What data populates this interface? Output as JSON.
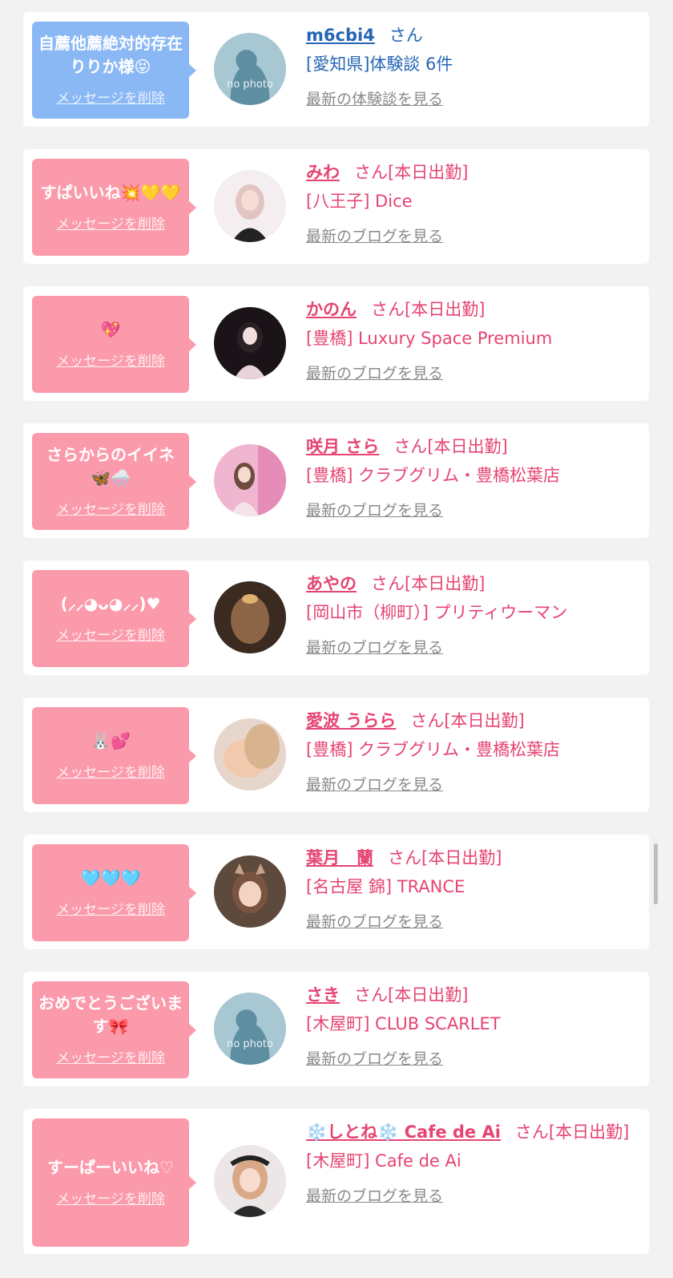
{
  "delete_label": "メッセージを削除",
  "san_label": "さん",
  "entries": [
    {
      "message": "自薦他薦絶対的存在りりか様😝",
      "name": "m6cbi4",
      "status": "",
      "shop": "[愛知県]体験談 6件",
      "link": "最新の体験談を見る",
      "avatar": "no photo",
      "color": "#2566b5"
    },
    {
      "message": "すぱいいね💥💛💛",
      "name": "みわ",
      "status": "[本日出勤]",
      "shop": "[八王子] Dice",
      "link": "最新のブログを見る",
      "avatar": "photo",
      "color": "#e64472"
    },
    {
      "message": "💖",
      "name": "かのん",
      "status": "[本日出勤]",
      "shop": "[豊橋] Luxury Space Premium",
      "link": "最新のブログを見る",
      "avatar": "photo",
      "color": "#e64472"
    },
    {
      "message": "さらからのイイネ🦋🌨️",
      "name": "咲月 さら",
      "status": "[本日出勤]",
      "shop": "[豊橋] クラブグリム・豊橋松葉店",
      "link": "最新のブログを見る",
      "avatar": "photo",
      "color": "#e64472"
    },
    {
      "message": "(⸝⸝◕ᴗ◕⸝⸝)♥",
      "name": "あやの",
      "status": "[本日出勤]",
      "shop": "[岡山市（柳町）] プリティウーマン",
      "link": "最新のブログを見る",
      "avatar": "photo",
      "color": "#e64472"
    },
    {
      "message": "🐰💕",
      "name": "愛波 うらら",
      "status": "[本日出勤]",
      "shop": "[豊橋] クラブグリム・豊橋松葉店",
      "link": "最新のブログを見る",
      "avatar": "photo",
      "color": "#e64472"
    },
    {
      "message": "🩵🩵🩵",
      "name": "葉月　蘭",
      "status": "[本日出勤]",
      "shop": "[名古屋 錦] TRANCE",
      "link": "最新のブログを見る",
      "avatar": "photo",
      "color": "#e64472"
    },
    {
      "message": "おめでとうございます🎀",
      "name": "さき",
      "status": "[本日出勤]",
      "shop": "[木屋町] CLUB SCARLET",
      "link": "最新のブログを見る",
      "avatar": "no photo",
      "color": "#e64472"
    },
    {
      "message": "すーぱーいいね♡",
      "name": "❄️しとね❄️ Cafe de Ai",
      "status": "[本日出勤]",
      "shop": "[木屋町] Cafe de Ai",
      "link": "最新のブログを見る",
      "avatar": "photo",
      "color": "#e64472"
    }
  ]
}
